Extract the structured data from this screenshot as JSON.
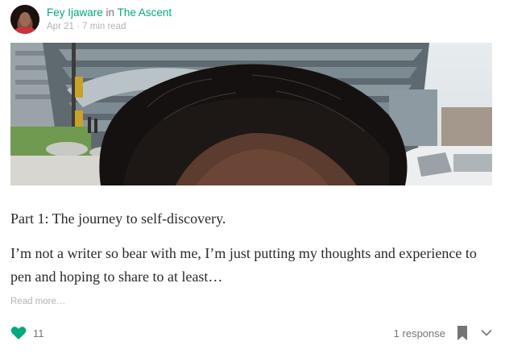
{
  "post": {
    "author": "Fey Ijaware",
    "in_text": "in",
    "publication": "The Ascent",
    "date": "Apr 21",
    "separator": "·",
    "read_time": "7 min read",
    "subtitle": "Part 1: The journey to self-discovery.",
    "excerpt": "I’m not a writer so bear with me, I’m just putting my thoughts and experience to pen and hoping to share to at least…",
    "read_more": "Read more…",
    "claps": "11",
    "responses": "1 response"
  },
  "icons": {
    "avatar": "author-avatar",
    "clap": "heart-icon",
    "bookmark": "bookmark-icon",
    "more": "chevron-down-icon"
  },
  "colors": {
    "accent": "#03a87c",
    "muted_text": "#757575",
    "light_text": "#b3b3b3",
    "body_text": "#292929"
  }
}
